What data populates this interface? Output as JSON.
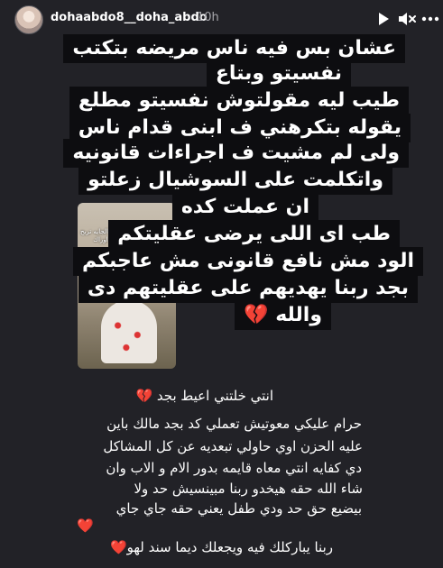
{
  "header": {
    "username": "dohaabdo8__doha_abdo",
    "timestamp": "10h",
    "play_icon": "play-icon",
    "mute_icon": "speaker-off-icon",
    "more_icon": "more-icon"
  },
  "thumbnail": {
    "caption": "منور عمارة اوراك الحياه الجايه تربح بمصاريفك من قدام اوراك"
  },
  "dark_text": [
    "عشان بس فيه ناس مريضه بتكتب",
    "نفسيتو وبتاع",
    "طيب ليه مقولتوش نفسيتو مطلع",
    "يقوله بتكرهني ف ابنى قدام ناس",
    "ولى لم مشيت ف اجراءات قانونيه",
    "واتكلمت على السوشيال زعلتو",
    "ان عملت كده",
    "طب اى اللى يرضى عقليتكم",
    "الود مش نافع قانونى مش عاجبكم",
    "بجد ربنا يهديهم على عقليتهم دى",
    "والله 💔"
  ],
  "plain_text": [
    "انتي خلتني اعيط بجد 💔",
    "حرام عليكي معوتيش تعملي كد بجد مالك باين",
    "عليه الحزن اوي حاولي تبعديه عن كل المشاكل",
    "دي كفايه انتي معاه قايمه بدور الام و الاب وان",
    "شاء الله حقه هيخدو ربنا مبينسيش حد ولا",
    "بيضيع حق حد ودي طفل يعني حقه جاي جاي",
    "❤️",
    "ربنا يباركلك فيه ويجعلك ديما سند لهو❤️"
  ]
}
